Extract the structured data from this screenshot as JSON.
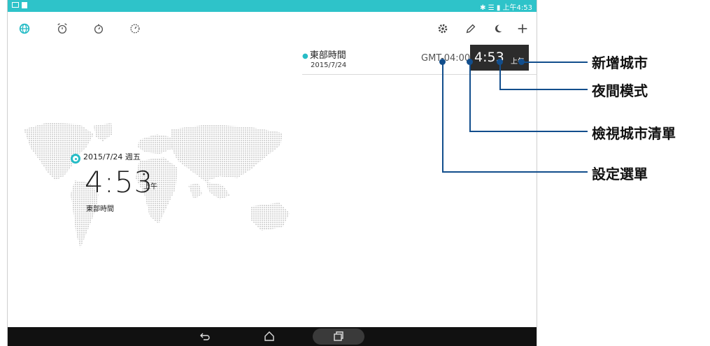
{
  "statusbar": {
    "right_text": "✱ ☰ ▮ 上午4:53"
  },
  "toolbar": {
    "left_icons": [
      "world-clock-icon",
      "alarm-icon",
      "stopwatch-icon",
      "timer-icon"
    ],
    "right_icons": [
      "settings-icon",
      "edit-icon",
      "night-mode-icon",
      "add-icon"
    ]
  },
  "city_row": {
    "city": "東部時間",
    "date": "2015/7/24",
    "gmt": "GMT-04:00",
    "time": "4:53",
    "ampm": "上午"
  },
  "main_clock": {
    "date": "2015/7/24 週五",
    "time": "4:53",
    "ampm": "上午",
    "timezone": "東部時間"
  },
  "callouts": {
    "add_city": "新增城市",
    "night_mode": "夜間模式",
    "view_city_list": "檢視城市清單",
    "settings_menu": "設定選單"
  },
  "colors": {
    "accent": "#27bcc6",
    "statusbar": "#2ec3c9",
    "callout": "#124e8c"
  }
}
